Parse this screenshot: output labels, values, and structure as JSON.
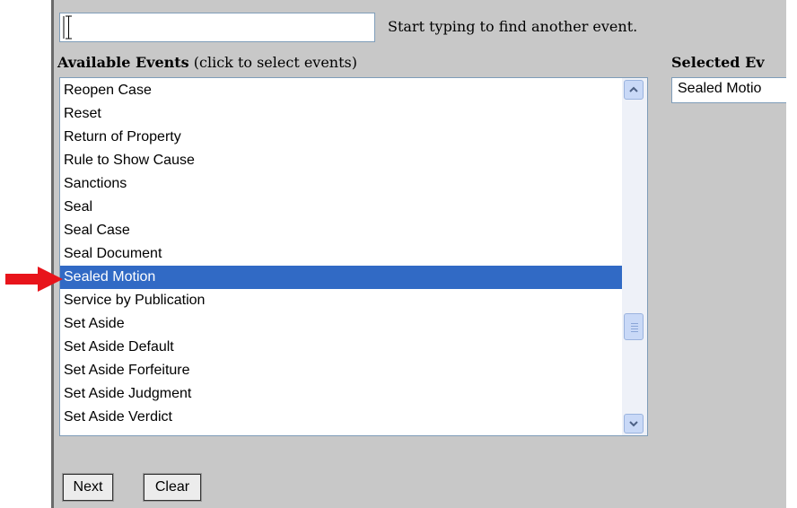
{
  "search": {
    "value": "",
    "hint": "Start typing to find another event."
  },
  "available": {
    "title_bold": "Available Events",
    "title_rest": " (click to select events)",
    "options": [
      "Reopen Case",
      "Reset",
      "Return of Property",
      "Rule to Show Cause",
      "Sanctions",
      "Seal",
      "Seal Case",
      "Seal Document",
      "Sealed Motion",
      "Service by Publication",
      "Set Aside",
      "Set Aside Default",
      "Set Aside Forfeiture",
      "Set Aside Judgment",
      "Set Aside Verdict"
    ],
    "selected_option": "Sealed Motion"
  },
  "selected": {
    "title": "Selected Ev",
    "items": [
      "Sealed Motio"
    ]
  },
  "buttons": {
    "next": "Next",
    "clear": "Clear"
  },
  "colors": {
    "selection": "#316ac5",
    "panel": "#c8c8c8",
    "pointer_arrow": "#e8141b"
  }
}
